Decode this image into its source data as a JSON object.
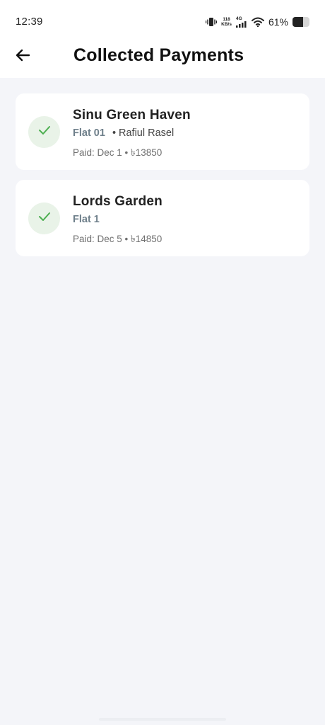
{
  "status_bar": {
    "time": "12:39",
    "speed_value": "118",
    "speed_unit": "KB/s",
    "network": "4G",
    "battery_percent_label": "61%",
    "battery_level": 0.61,
    "icons": [
      "vibrate-icon",
      "signal-icon",
      "wifi-icon",
      "battery-icon"
    ]
  },
  "header": {
    "title": "Collected Payments",
    "back_icon": "arrow-left-icon"
  },
  "payments": [
    {
      "property": "Sinu Green Haven",
      "flat": "Flat 01",
      "tenant_separator": "•",
      "tenant": "Rafiul Rasel",
      "paid": "Paid: Dec 1 • ৳13850",
      "status_icon": "check-icon"
    },
    {
      "property": "Lords Garden",
      "flat": "Flat 1",
      "tenant_separator": "",
      "tenant": "",
      "paid": "Paid: Dec 5 • ৳14850",
      "status_icon": "check-icon"
    }
  ],
  "colors": {
    "background": "#f4f5f9",
    "card": "#ffffff",
    "check_green": "#4caf50",
    "check_bg": "#e9f3e8",
    "flat_label": "#6e7f8a"
  }
}
